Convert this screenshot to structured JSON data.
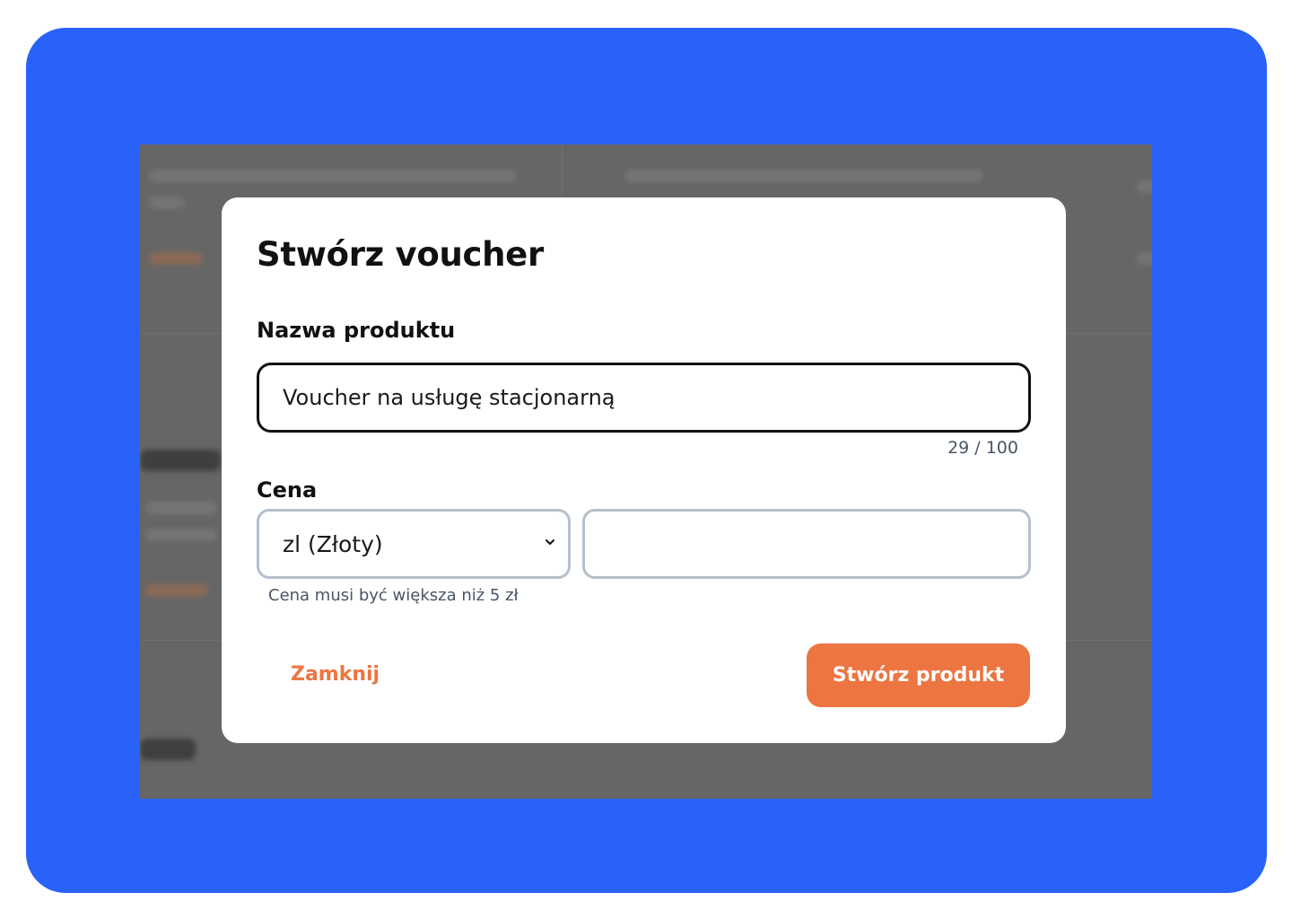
{
  "modal": {
    "title": "Stwórz voucher",
    "product_name": {
      "label": "Nazwa produktu",
      "value": "Voucher na usługę stacjonarną",
      "counter": "29 / 100"
    },
    "price": {
      "label": "Cena",
      "currency_selected": "zl (Złoty)",
      "amount_value": "",
      "hint": "Cena musi być większa niż 5 zł"
    },
    "actions": {
      "close_label": "Zamknij",
      "create_label": "Stwórz produkt"
    }
  },
  "colors": {
    "frame_background": "#2962f8",
    "overlay": "#666666",
    "accent": "#ec7541",
    "input_border_active": "#111111",
    "input_border": "#b6c0cc"
  },
  "icons": {
    "select_indicator": "chevron-down-icon"
  }
}
